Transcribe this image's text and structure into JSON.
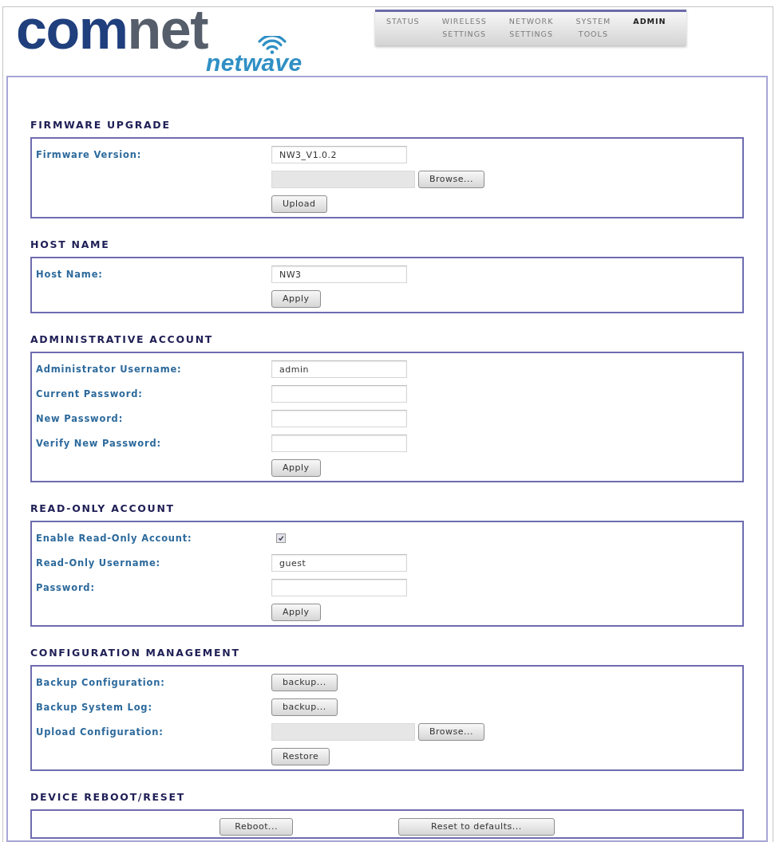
{
  "logo": {
    "wordmark": [
      "com",
      "net"
    ],
    "product": "netwave"
  },
  "nav": {
    "tabs": [
      {
        "label": "STATUS",
        "selected": false
      },
      {
        "label": "WIRELESS SETTINGS",
        "selected": false
      },
      {
        "label": "NETWORK SETTINGS",
        "selected": false
      },
      {
        "label": "SYSTEM TOOLS",
        "selected": false
      },
      {
        "label": "ADMIN",
        "selected": true
      }
    ]
  },
  "sections": [
    {
      "title": "FIRMWARE UPGRADE",
      "rows": [
        {
          "kind": "text",
          "label": "Firmware Version:",
          "value": "NW3_V1.0.2"
        },
        {
          "kind": "file",
          "button": "Browse..."
        },
        {
          "kind": "button",
          "button": "Upload"
        }
      ]
    },
    {
      "title": "HOST NAME",
      "rows": [
        {
          "kind": "text",
          "label": "Host Name:",
          "value": "NW3"
        },
        {
          "kind": "button",
          "button": "Apply"
        }
      ]
    },
    {
      "title": "ADMINISTRATIVE ACCOUNT",
      "rows": [
        {
          "kind": "text",
          "label": "Administrator Username:",
          "value": "admin"
        },
        {
          "kind": "text",
          "label": "Current Password:"
        },
        {
          "kind": "text",
          "label": "New Password:"
        },
        {
          "kind": "text",
          "label": "Verify New Password:"
        },
        {
          "kind": "button",
          "button": "Apply"
        }
      ]
    },
    {
      "title": "READ-ONLY ACCOUNT",
      "rows": [
        {
          "kind": "checkbox",
          "label": "Enable Read-Only Account:",
          "checked": true
        },
        {
          "kind": "text",
          "label": "Read-Only Username:",
          "value": "guest"
        },
        {
          "kind": "text",
          "label": "Password:"
        },
        {
          "kind": "button",
          "button": "Apply"
        }
      ]
    },
    {
      "title": "CONFIGURATION MANAGEMENT",
      "rows": [
        {
          "kind": "button",
          "label": "Backup Configuration:",
          "button": "backup..."
        },
        {
          "kind": "button",
          "label": "Backup System Log:",
          "button": "backup..."
        },
        {
          "kind": "file",
          "label": "Upload Configuration:",
          "button": "Browse..."
        },
        {
          "kind": "button",
          "button": "Restore"
        }
      ]
    },
    {
      "title": "DEVICE REBOOT/RESET",
      "rows": [
        {
          "kind": "buttons",
          "buttons": [
            "Reboot...",
            "Reset to defaults..."
          ]
        }
      ]
    }
  ]
}
